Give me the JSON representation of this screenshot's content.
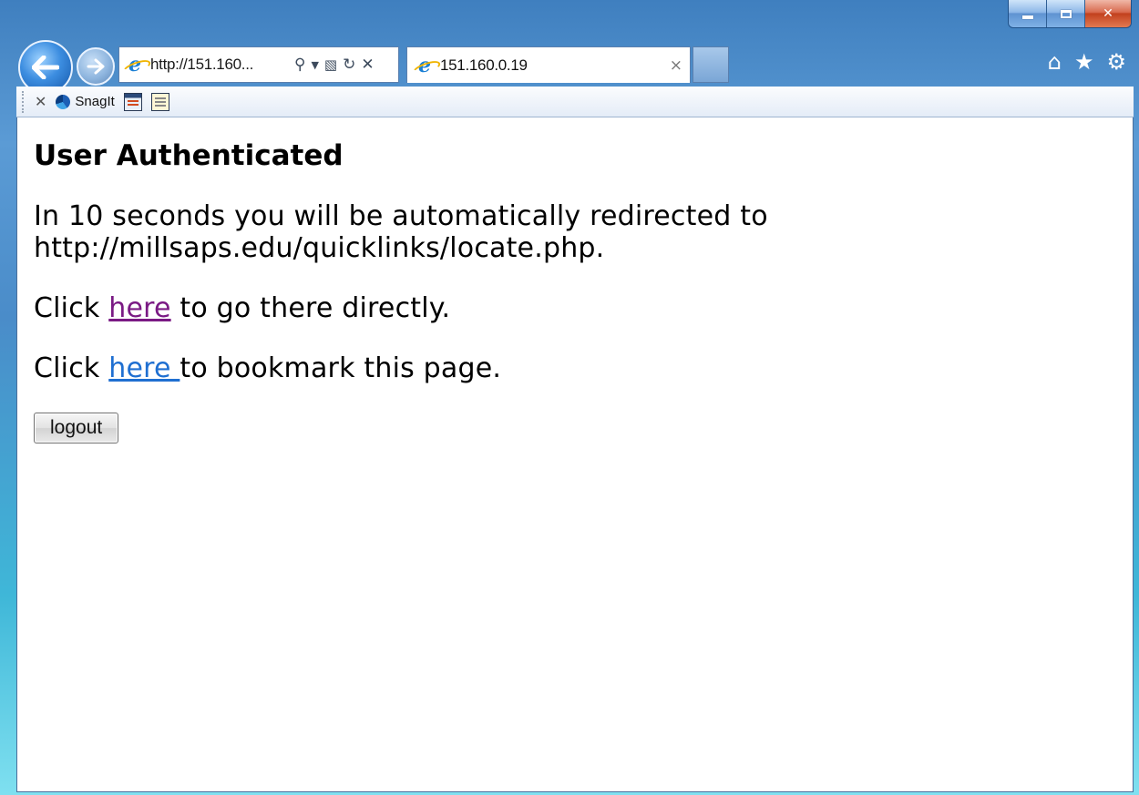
{
  "browser": {
    "address_url": "http://151.160...",
    "tab_title": "151.160.0.19",
    "toolbar_snagit": "SnagIt"
  },
  "page": {
    "title": "User Authenticated",
    "redirect_line1": "In 10 seconds you will be automatically redirected to",
    "redirect_line2": "http://millsaps.edu/quicklinks/locate.php.",
    "click_prefix": "Click ",
    "link_here": "here",
    "direct_suffix": " to go there directly.",
    "link_here_bookmark": "here ",
    "bookmark_suffix": "to bookmark this page.",
    "logout_label": "logout"
  },
  "colors": {
    "visited_link": "#7a1a84",
    "link": "#1f6fd1"
  }
}
